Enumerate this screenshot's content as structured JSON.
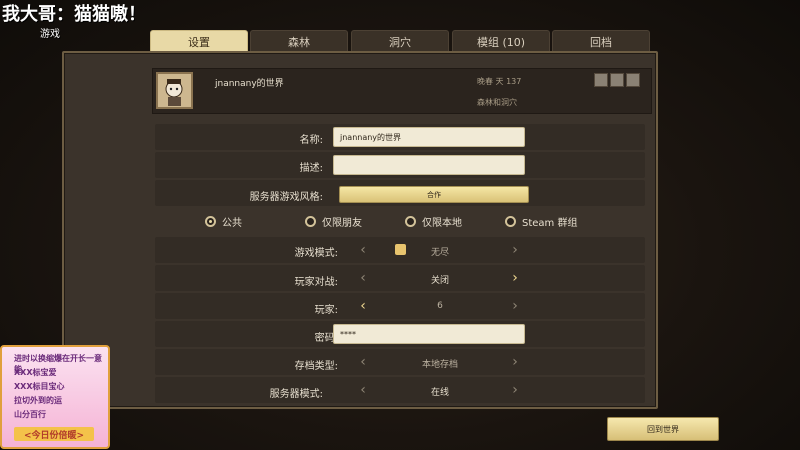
{
  "overlay": {
    "title": "我大哥：猫猫嗷！",
    "sub": "游戏"
  },
  "tabs": [
    {
      "label": "设置",
      "active": true
    },
    {
      "label": "森林",
      "active": false
    },
    {
      "label": "洞穴",
      "active": false
    },
    {
      "label": "模组 (10)",
      "active": false
    },
    {
      "label": "回档",
      "active": false
    }
  ],
  "world": {
    "name": "jnannany的世界",
    "day": "晚春 天 137",
    "location": "森林和洞穴"
  },
  "settings": {
    "name_label": "名称:",
    "name_value": "jnannany的世界",
    "desc_label": "描述:",
    "desc_value": "",
    "style_label": "服务器游戏风格:",
    "style_value": "合作",
    "privacy_options": [
      "公共",
      "仅限朋友",
      "仅限本地",
      "Steam 群组"
    ],
    "privacy_selected": "公共",
    "mode_label": "游戏模式:",
    "mode_value": "无尽",
    "pvp_label": "玩家对战:",
    "pvp_value": "关闭",
    "players_label": "玩家:",
    "players_value": "6",
    "password_label": "密码:",
    "password_value": "****",
    "save_label": "存档类型:",
    "save_value": "本地存档",
    "server_label": "服务器模式:",
    "server_value": "在线"
  },
  "buttons": {
    "return": "回到世界"
  },
  "promo": {
    "lines": [
      "进时以换缩爆在开长一意能",
      "XXX标宝爱",
      "XXX标目宝心",
      "拉切外到的运",
      "山分百行"
    ],
    "title": "<今日份倍暖>"
  },
  "icons": [
    "avatar-portrait",
    "world-icon-1",
    "world-icon-2",
    "world-icon-3",
    "chevron-left-icon",
    "chevron-right-icon"
  ]
}
